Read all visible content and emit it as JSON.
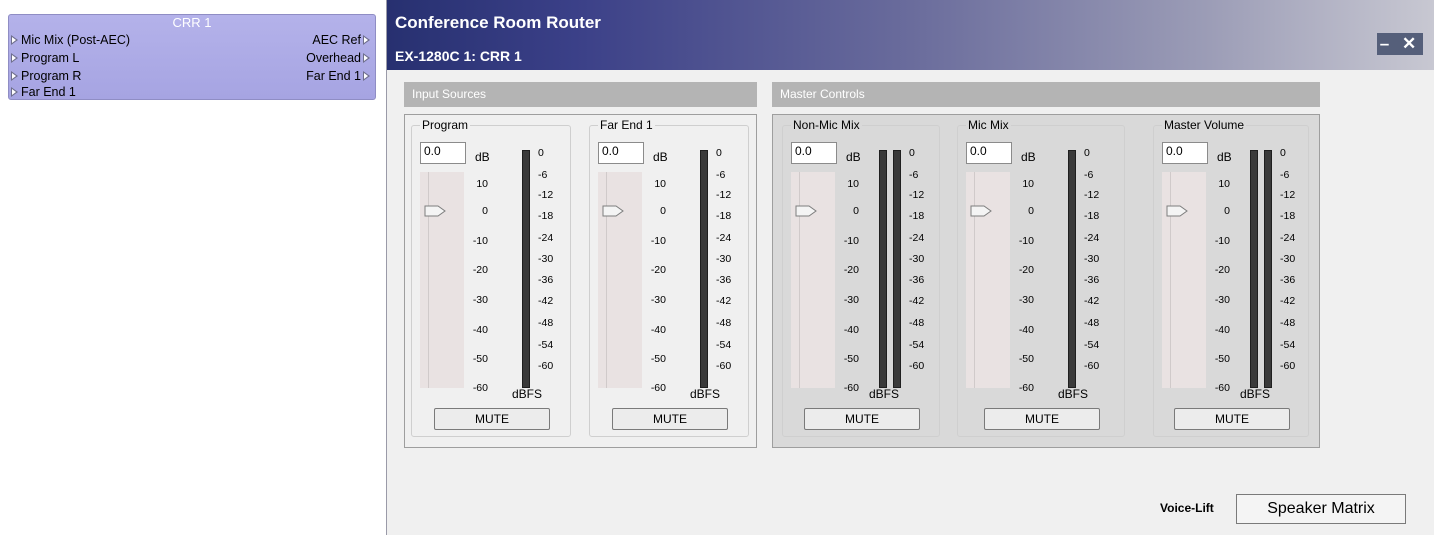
{
  "block": {
    "title": "CRR 1",
    "inputs": [
      "Mic Mix (Post-AEC)",
      "Program L",
      "Program R",
      "Far End 1"
    ],
    "outputs": [
      "AEC Ref",
      "Overhead",
      "Far End 1"
    ]
  },
  "window": {
    "title": "Conference Room Router",
    "subtitle": "EX-1280C 1: CRR 1",
    "controls_label": "– ✕"
  },
  "input_sources": {
    "header": "Input Sources",
    "strips": [
      {
        "label": "Program",
        "value": "0.0",
        "unit": "dB",
        "mute": "MUTE",
        "meter_label": "dBFS",
        "meters": 1
      },
      {
        "label": "Far End 1",
        "value": "0.0",
        "unit": "dB",
        "mute": "MUTE",
        "meter_label": "dBFS",
        "meters": 1
      }
    ]
  },
  "master_controls": {
    "header": "Master Controls",
    "strips": [
      {
        "label": "Non-Mic Mix",
        "value": "0.0",
        "unit": "dB",
        "mute": "MUTE",
        "meter_label": "dBFS",
        "meters": 2
      },
      {
        "label": "Mic Mix",
        "value": "0.0",
        "unit": "dB",
        "mute": "MUTE",
        "meter_label": "dBFS",
        "meters": 1
      },
      {
        "label": "Master Volume",
        "value": "0.0",
        "unit": "dB",
        "mute": "MUTE",
        "meter_label": "dBFS",
        "meters": 2
      }
    ]
  },
  "fader_scale": [
    "10",
    "0",
    "-10",
    "-20",
    "-30",
    "-40",
    "-50",
    "-60"
  ],
  "meter_scale": [
    "0",
    "-6",
    "-12",
    "-18",
    "-24",
    "-30",
    "-36",
    "-42",
    "-48",
    "-54",
    "-60"
  ],
  "fader_level_db": 0,
  "footer": {
    "voice_lift": "Voice-Lift",
    "speaker_matrix": "Speaker Matrix"
  }
}
